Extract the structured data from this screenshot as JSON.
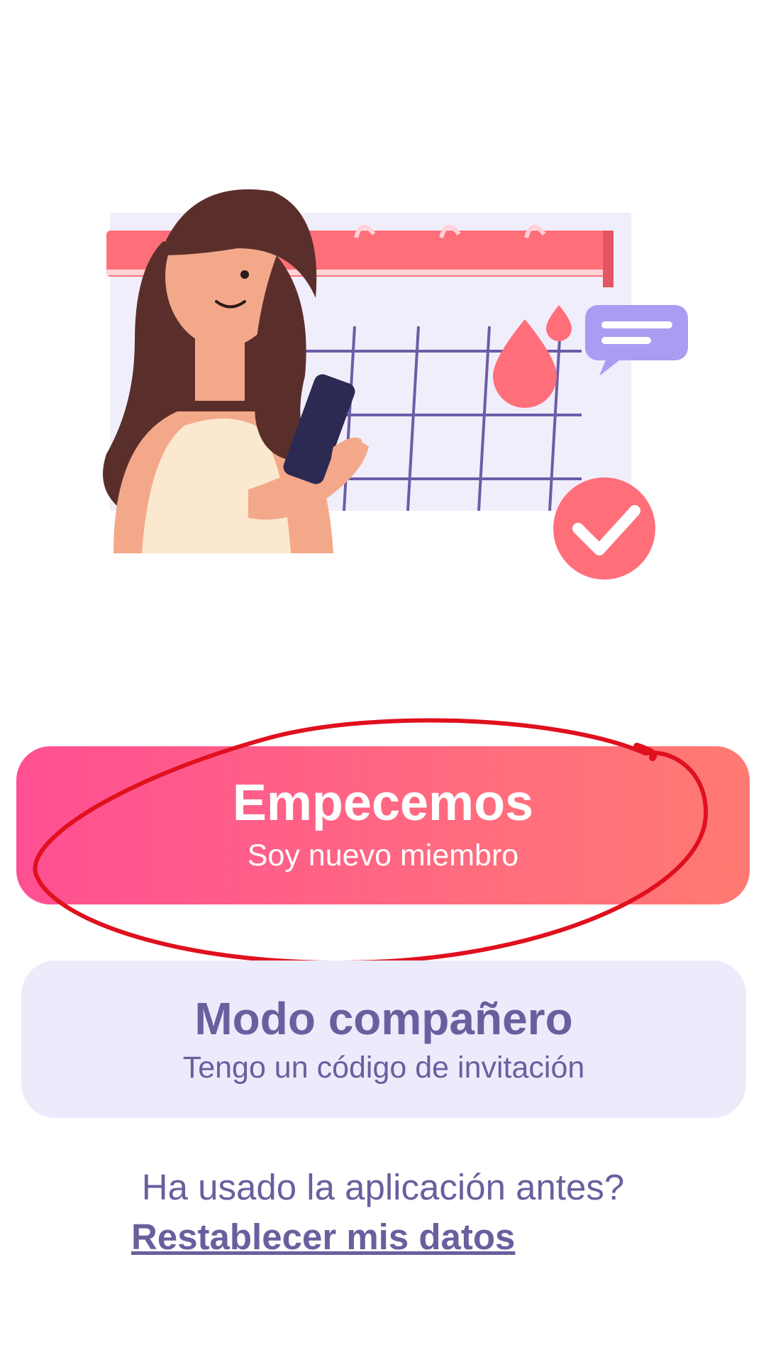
{
  "start_button": {
    "title": "Empecemos",
    "subtitle": "Soy nuevo miembro"
  },
  "partner_button": {
    "title": "Modo compañero",
    "subtitle": "Tengo un código de invitación"
  },
  "restore": {
    "question": "Ha usado la aplicación antes?",
    "link_label": "Restablecer mis datos"
  },
  "colors": {
    "primary_gradient_start": "#ff4f93",
    "primary_gradient_end": "#ff7a72",
    "secondary_background": "#ecebfb",
    "secondary_text": "#6a5f9e",
    "annotation_stroke": "#e0101e"
  }
}
